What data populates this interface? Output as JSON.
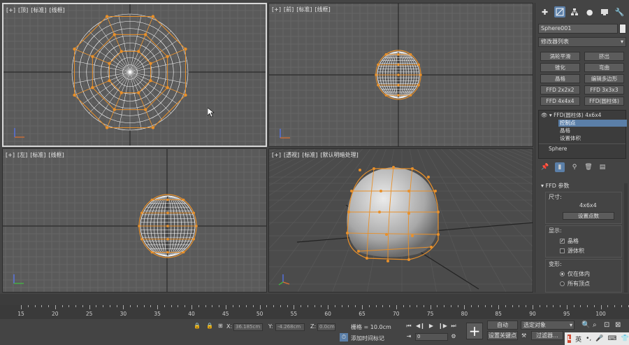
{
  "viewports": {
    "top": {
      "label": [
        "[+]",
        "[顶]",
        "[标准]",
        "[线框]"
      ]
    },
    "front": {
      "label": [
        "[+]",
        "[前]",
        "[标准]",
        "[线框]"
      ]
    },
    "left": {
      "label": [
        "[+]",
        "[左]",
        "[标准]",
        "[线框]"
      ]
    },
    "perspective": {
      "label": [
        "[+]",
        "[透视]",
        "[标准]",
        "[默认明暗处理]"
      ]
    }
  },
  "panel": {
    "tabs": [
      "create-icon",
      "modify-icon",
      "hierarchy-icon",
      "motion-icon",
      "display-icon",
      "utilities-icon"
    ],
    "object_name": "Sphere001",
    "object_color": "#e6e6e6",
    "modifier_list": "修改器列表",
    "modifier_buttons": [
      "涡轮平滑",
      "挤出",
      "锥化",
      "弯曲",
      "晶格",
      "编辑多边形",
      "FFD 2x2x2",
      "FFD 3x3x3",
      "FFD 4x4x4",
      "FFD(圆柱体)"
    ],
    "stack": {
      "ffd": "FFD(圆柱体) 4x6x4",
      "control_points": "控制点",
      "lattice": "晶格",
      "set_volume": "设置体积",
      "sphere": "Sphere"
    },
    "rollout": {
      "title": "FFD 参数",
      "dimensions_label": "尺寸:",
      "dimensions_value": "4x6x4",
      "set_points_button": "设置点数",
      "display_label": "显示:",
      "lattice_check": "晶格",
      "lattice_checked": true,
      "source_volume_check": "源体积",
      "source_volume_checked": false,
      "deform_label": "变形:",
      "only_in_volume": "仅在体内",
      "all_vertices": "所有顶点",
      "selected_radio": "only_in_volume"
    }
  },
  "timeline": {
    "ticks": [
      "15",
      "20",
      "25",
      "30",
      "35",
      "40",
      "45",
      "50",
      "55",
      "60",
      "65",
      "70",
      "75",
      "80",
      "85",
      "90",
      "95",
      "100"
    ]
  },
  "status": {
    "x_label": "X:",
    "x_value": "36.185cm",
    "y_label": "Y:",
    "y_value": "-4.268cm",
    "z_label": "Z:",
    "z_value": "0.0cm",
    "grid_text": "栅格 = 10.0cm",
    "add_time_tag": "添加时间标记",
    "auto_button": "自动",
    "selected_object": "选定对象",
    "set_key_button": "设置关键点",
    "key_filters": "过滤器...",
    "frame_value": "0",
    "tray_lang": "英"
  },
  "accent_color": "#5b7fa8",
  "lattice_color": "#e8902a"
}
